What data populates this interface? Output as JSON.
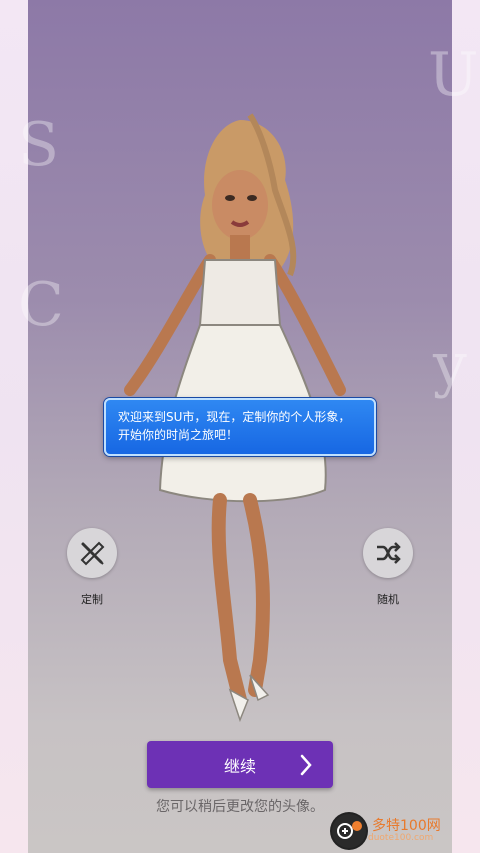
{
  "dialog": {
    "message": "欢迎来到SU市，现在，定制你的个人形象，开始你的时尚之旅吧！"
  },
  "actions": {
    "customize_label": "定制",
    "random_label": "随机"
  },
  "footer": {
    "continue_label": "继续",
    "hint": "您可以稍后更改您的头像。"
  },
  "watermark": {
    "text": "多特100网",
    "sub": "duote100.com"
  },
  "colors": {
    "accent": "#6d31b5",
    "dialog": "#2f88f2"
  }
}
